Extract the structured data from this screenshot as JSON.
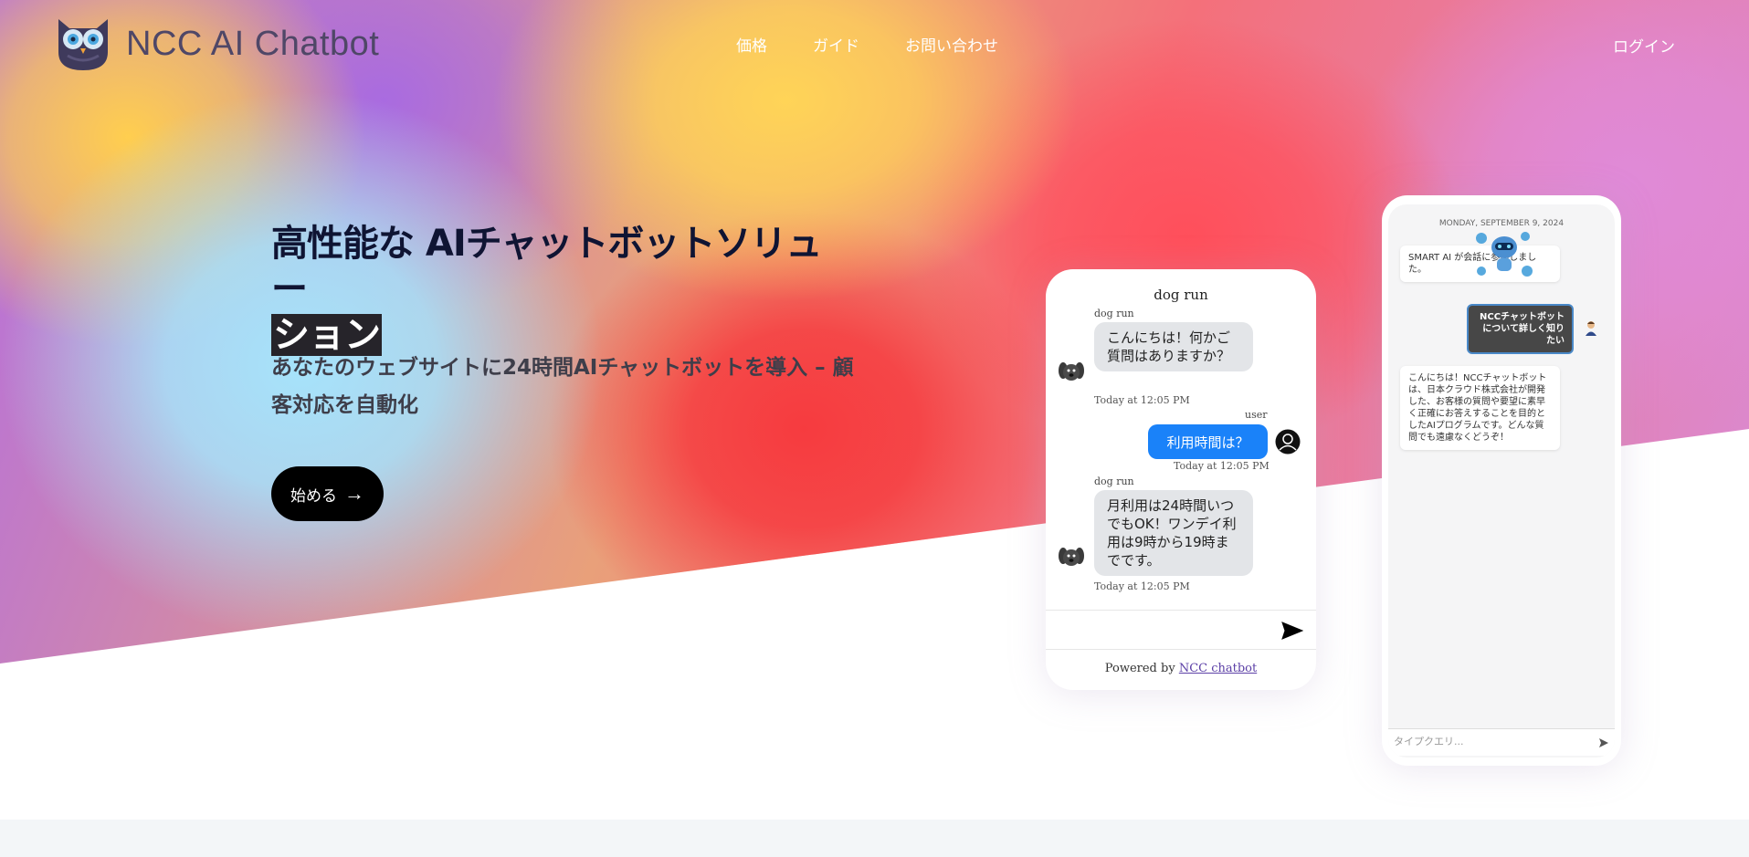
{
  "header": {
    "brand_name": "NCC AI Chatbot",
    "nav": [
      {
        "label": "価格"
      },
      {
        "label": "ガイド"
      },
      {
        "label": "お問い合わせ"
      }
    ],
    "login_label": "ログイン"
  },
  "hero": {
    "headline_part1": "高性能な AIチャットボットソリュー",
    "headline_part2": "ション",
    "subtitle": "あなたのウェブサイトに24時間AIチャットボットを導入 – 顧客対応を自動化",
    "cta_label": "始める",
    "cta_icon": "→"
  },
  "phone1": {
    "title": "dog run",
    "messages": [
      {
        "sender": "dog run",
        "text": "こんにちは！何かご質問はありますか？",
        "time": "Today at 12:05 PM"
      },
      {
        "sender": "user",
        "text": "利用時間は？",
        "time": "Today at 12:05 PM"
      },
      {
        "sender": "dog run",
        "text": "月利用は24時間いつでもOK！ワンデイ利用は9時から19時までです。",
        "time": "Today at 12:05 PM"
      }
    ],
    "footer_prefix": "Powered by",
    "footer_link": "NCC chatbot"
  },
  "phone2": {
    "date": "MONDAY, SEPTEMBER 9, 2024",
    "bot_msg1": "SMART AI が会話に参加しました。",
    "user_msg": "NCCチャットボットについて詳しく知りたい",
    "bot_msg2": "こんにちは！NCCチャットボットは、日本クラウド株式会社が開発した、お客様の質問や要望に素早く正確にお答えすることを目的としたAIプログラムです。どんな質問でも遠慮なくどうぞ！",
    "input_placeholder": "タイプクエリ..."
  },
  "colors": {
    "brand_text": "#4f4767",
    "headline": "#0f1433",
    "user_bubble": "#1a82f9",
    "cta_bg": "#000000"
  }
}
